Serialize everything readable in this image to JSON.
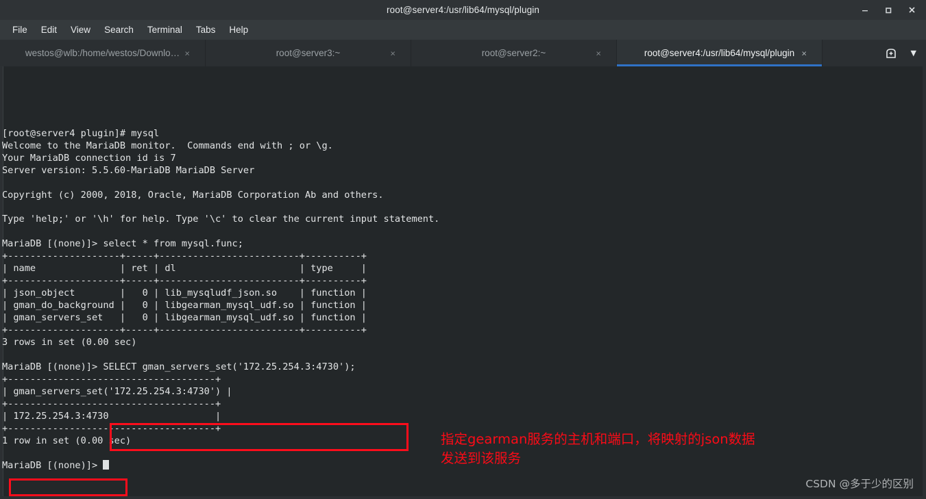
{
  "window": {
    "title": "root@server4:/usr/lib64/mysql/plugin",
    "controls": [
      {
        "name": "minimize",
        "glyph": "–"
      },
      {
        "name": "maximize",
        "glyph": "□"
      },
      {
        "name": "close",
        "glyph": "✕"
      }
    ]
  },
  "menubar": {
    "items": [
      "File",
      "Edit",
      "View",
      "Search",
      "Terminal",
      "Tabs",
      "Help"
    ]
  },
  "tabbar": {
    "tabs": [
      {
        "label": "westos@wlb:/home/westos/Downlo…",
        "close": "×",
        "active": false
      },
      {
        "label": "root@server3:~",
        "close": "×",
        "active": false
      },
      {
        "label": "root@server2:~",
        "close": "×",
        "active": false
      },
      {
        "label": "root@server4:/usr/lib64/mysql/plugin",
        "close": "×",
        "active": true
      }
    ],
    "new_tab_label": "new-tab",
    "menu_glyph": "▼"
  },
  "terminal": {
    "lines": [
      "",
      "",
      "",
      "",
      "",
      "[root@server4 plugin]# mysql",
      "Welcome to the MariaDB monitor.  Commands end with ; or \\g.",
      "Your MariaDB connection id is 7",
      "Server version: 5.5.60-MariaDB MariaDB Server",
      "",
      "Copyright (c) 2000, 2018, Oracle, MariaDB Corporation Ab and others.",
      "",
      "Type 'help;' or '\\h' for help. Type '\\c' to clear the current input statement.",
      "",
      "MariaDB [(none)]> select * from mysql.func;",
      "+--------------------+-----+-------------------------+----------+",
      "| name               | ret | dl                      | type     |",
      "+--------------------+-----+-------------------------+----------+",
      "| json_object        |   0 | lib_mysqludf_json.so    | function |",
      "| gman_do_background |   0 | libgearman_mysql_udf.so | function |",
      "| gman_servers_set   |   0 | libgearman_mysql_udf.so | function |",
      "+--------------------+-----+-------------------------+----------+",
      "3 rows in set (0.00 sec)",
      "",
      "MariaDB [(none)]> SELECT gman_servers_set('172.25.254.3:4730');",
      "+-------------------------------------+",
      "| gman_servers_set('172.25.254.3:4730') |",
      "+-------------------------------------+",
      "| 172.25.254.3:4730                   |",
      "+-------------------------------------+",
      "1 row in set (0.00 sec)",
      ""
    ],
    "prompt_last": "MariaDB [(none)]> ",
    "cursor": "block"
  },
  "annotation": {
    "color": "#fb0b17",
    "lines": [
      "指定gearman服务的主机和端口，将映射的json数据",
      "发送到该服务"
    ],
    "highlight_boxes": [
      {
        "name": "select-statement",
        "label": "SELECT gman_servers_set('172.25.254.3:4730');"
      },
      {
        "name": "result-value",
        "label": "172.25.254.3:4730"
      }
    ]
  },
  "watermark": {
    "text": "CSDN @多于少的区别"
  }
}
